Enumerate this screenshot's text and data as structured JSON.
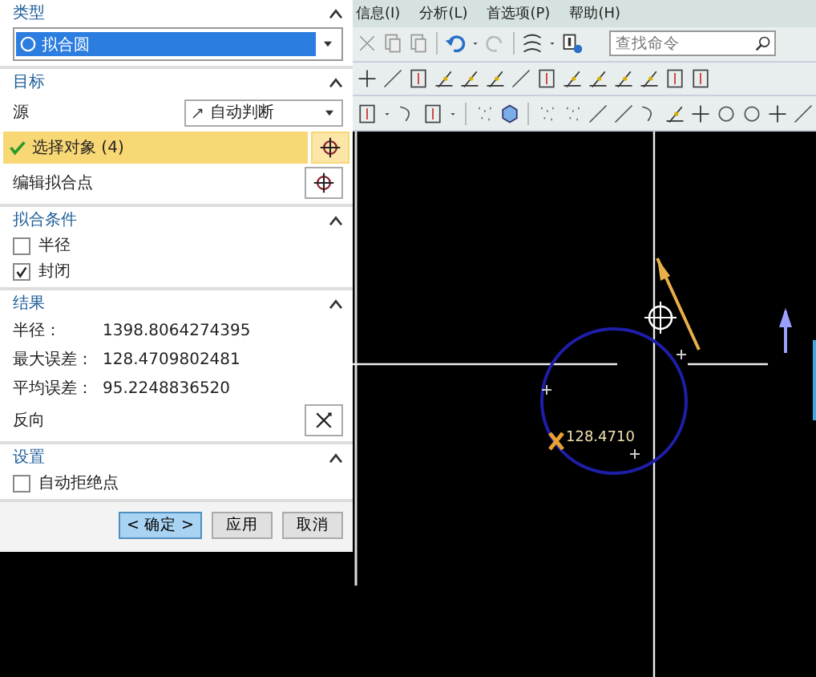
{
  "dialog": {
    "sections": [
      {
        "kind": "type",
        "title": "类型",
        "value": "拟合圆"
      },
      {
        "kind": "target",
        "title": "目标",
        "source_label": "源",
        "source_value": "自动判断",
        "select_label": "选择对象 (4)",
        "select_selected": true,
        "edit_label": "编辑拟合点"
      },
      {
        "kind": "checks",
        "title": "拟合条件",
        "checkboxes": [
          {
            "label": "半径",
            "checked": false
          },
          {
            "label": "封闭",
            "checked": true
          }
        ]
      },
      {
        "kind": "results",
        "title": "结果",
        "rows": [
          {
            "label": "半径：",
            "value": "1398.8064274395"
          },
          {
            "label": "最大误差：",
            "value": "128.4709802481"
          },
          {
            "label": "平均误差：",
            "value": "95.2248836520"
          }
        ],
        "reverse_label": "反向"
      },
      {
        "kind": "checks",
        "title": "设置",
        "checkboxes": [
          {
            "label": "自动拒绝点",
            "checked": false
          }
        ]
      }
    ],
    "buttons": [
      {
        "label": "< 确定 >",
        "default": true
      },
      {
        "label": "应用",
        "default": false
      },
      {
        "label": "取消",
        "default": false
      }
    ]
  },
  "menu": [
    "信息(I)",
    "分析(L)",
    "首选项(P)",
    "帮助(H)"
  ],
  "search": {
    "placeholder": "查找命令"
  },
  "canvas": {
    "dimension_label": "128.4710"
  }
}
